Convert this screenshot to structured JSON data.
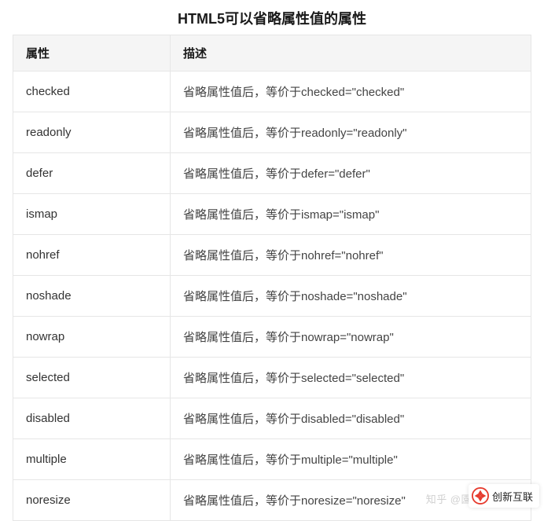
{
  "title": "HTML5可以省略属性值的属性",
  "columns": {
    "attr": "属性",
    "desc": "描述"
  },
  "rows": [
    {
      "attr": "checked",
      "desc": "省略属性值后，等价于checked=\"checked\""
    },
    {
      "attr": "readonly",
      "desc": "省略属性值后，等价于readonly=\"readonly\""
    },
    {
      "attr": "defer",
      "desc": "省略属性值后，等价于defer=\"defer\""
    },
    {
      "attr": "ismap",
      "desc": "省略属性值后，等价于ismap=\"ismap\""
    },
    {
      "attr": "nohref",
      "desc": "省略属性值后，等价于nohref=\"nohref\""
    },
    {
      "attr": "noshade",
      "desc": "省略属性值后，等价于noshade=\"noshade\""
    },
    {
      "attr": "nowrap",
      "desc": "省略属性值后，等价于nowrap=\"nowrap\""
    },
    {
      "attr": "selected",
      "desc": "省略属性值后，等价于selected=\"selected\""
    },
    {
      "attr": "disabled",
      "desc": "省略属性值后，等价于disabled=\"disabled\""
    },
    {
      "attr": "multiple",
      "desc": "省略属性值后，等价于multiple=\"multiple\""
    },
    {
      "attr": "noresize",
      "desc": "省略属性值后，等价于noresize=\"noresize\""
    }
  ],
  "watermark": "知乎 @園",
  "brand": "创新互联"
}
